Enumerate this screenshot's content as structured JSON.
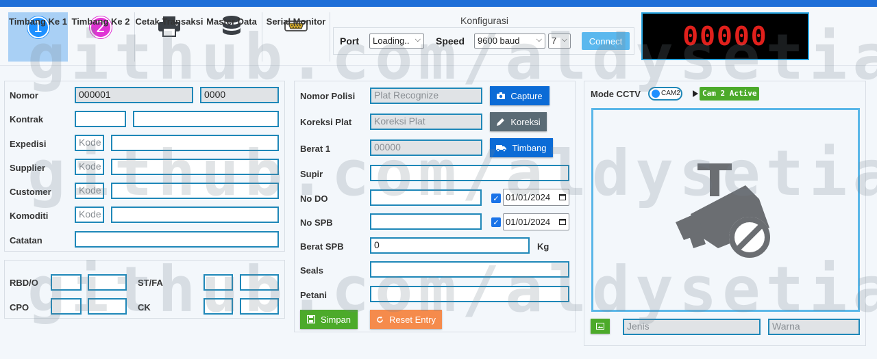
{
  "toolbar": {
    "items": [
      {
        "label": "Timbang Ke 1",
        "icon": "number-1-icon"
      },
      {
        "label": "Timbang Ke 2",
        "icon": "number-2-icon"
      },
      {
        "label": "Cetak Transaksi",
        "icon": "printer-icon"
      },
      {
        "label": "Master Data",
        "icon": "database-icon"
      },
      {
        "label": "Serial Monitor",
        "icon": "serial-port-icon"
      }
    ],
    "num1": "1",
    "num2": "2"
  },
  "config": {
    "title": "Konfigurasi",
    "port_label": "Port",
    "port_value": "Loading..",
    "speed_label": "Speed",
    "speed_value": "9600 baud",
    "bits_value": "7",
    "connect_label": "Connect"
  },
  "display": {
    "value": "00000",
    "color": "#e0201c"
  },
  "left_form": {
    "nomor_label": "Nomor",
    "nomor_value": "000001",
    "nomor_value2": "0000",
    "kontrak_label": "Kontrak",
    "expedisi_label": "Expedisi",
    "supplier_label": "Supplier",
    "customer_label": "Customer",
    "komoditi_label": "Komoditi",
    "catatan_label": "Catatan",
    "kode_placeholder": "Kode"
  },
  "quality": {
    "rbd_label": "RBD/O",
    "stfa_label": "ST/FA",
    "cpo_label": "CPO",
    "ck_label": "CK"
  },
  "middle_form": {
    "nomor_polisi_label": "Nomor Polisi",
    "nomor_polisi_placeholder": "Plat Recognize",
    "capture_label": "Capture",
    "koreksi_plat_label": "Koreksi Plat",
    "koreksi_plat_placeholder": "Koreksi Plat",
    "koreksi_label": "Koreksi",
    "berat1_label": "Berat 1",
    "berat1_placeholder": "00000",
    "timbang_label": "Timbang",
    "supir_label": "Supir",
    "nodo_label": "No DO",
    "nodo_date": "01/01/2024",
    "nospb_label": "No SPB",
    "nospb_date": "01/01/2024",
    "beratspb_label": "Berat SPB",
    "beratspb_value": "0",
    "kg_label": "Kg",
    "seals_label": "Seals",
    "petani_label": "Petani",
    "simpan_label": "Simpan",
    "reset_label": "Reset Entry"
  },
  "cctv": {
    "mode_label": "Mode CCTV",
    "toggle_label": "CAM2",
    "active_badge": "Cam 2 Active",
    "jenis_placeholder": "Jenis",
    "warna_placeholder": "Warna"
  },
  "colors": {
    "accent_blue": "#0b6bd6",
    "green": "#4caa2a",
    "orange": "#f58b4c",
    "field_border": "#1e87b8"
  },
  "watermark": "github.com/aldysetiaa"
}
